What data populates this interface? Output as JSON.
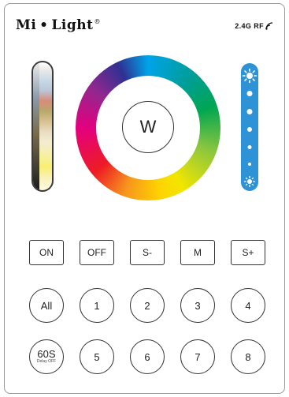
{
  "header": {
    "brand": "Mi • Light",
    "brand_mark": "®",
    "rf_label": "2.4G RF",
    "rf_icon": "signal-waves-icon"
  },
  "wheel": {
    "center_label": "W"
  },
  "temperature_strip": {
    "icon": "color-temperature-slider"
  },
  "brightness_strip": {
    "color": "#2e93d6",
    "top_icon": "sun-bright-icon",
    "bottom_icon": "sun-dim-icon",
    "dot_count": 5
  },
  "row1": [
    "ON",
    "OFF",
    "S-",
    "M",
    "S+"
  ],
  "row2": [
    "All",
    "1",
    "2",
    "3",
    "4"
  ],
  "row3": {
    "timer_main": "60S",
    "timer_sub": "Delay OFF",
    "zones": [
      "5",
      "6",
      "7",
      "8"
    ]
  }
}
